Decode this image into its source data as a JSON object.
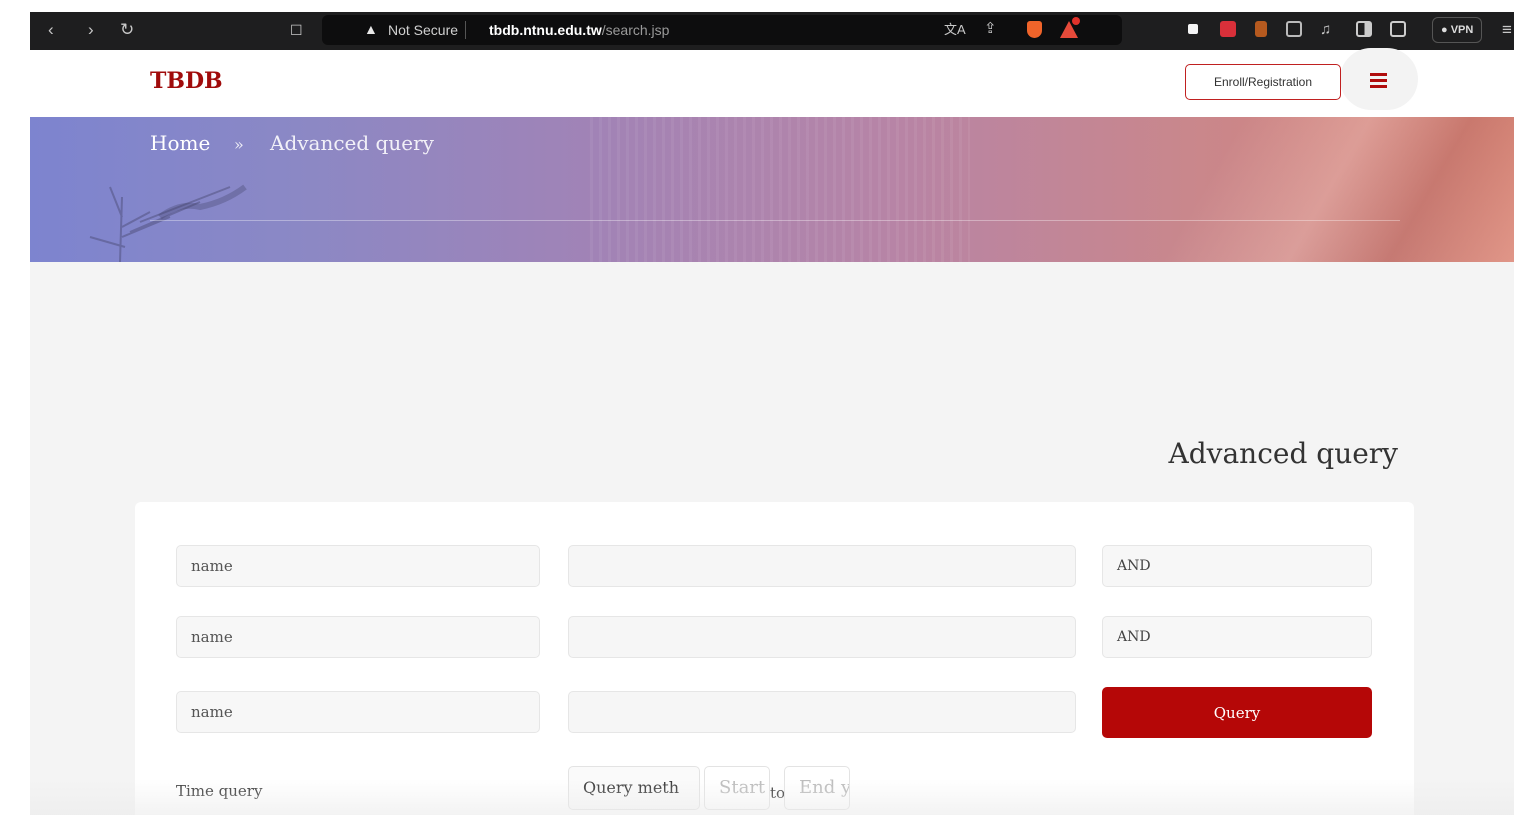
{
  "browser": {
    "nav_back": "‹",
    "nav_forward": "›",
    "reload": "↻",
    "bookmark": "☐",
    "warning_icon": "▲",
    "security_label": "Not Secure",
    "host": "tbdb.ntnu.edu.tw",
    "path": "/search.jsp",
    "translate_icon": "文A",
    "share_icon": "⇪",
    "vpn_label": "● VPN",
    "menu_icon": "≡"
  },
  "header": {
    "logo": "TBDB",
    "enroll_label": "Enroll/Registration"
  },
  "breadcrumb": {
    "home": "Home",
    "separator": "»",
    "current": "Advanced query"
  },
  "main": {
    "title": "Advanced query",
    "rows": [
      {
        "field": "name",
        "value": "",
        "logic": "AND"
      },
      {
        "field": "name",
        "value": "",
        "logic": "AND"
      },
      {
        "field": "name",
        "value": ""
      }
    ],
    "query_button": "Query",
    "time_query_label": "Time query",
    "query_method": "Query meth",
    "start_placeholder": "Start year",
    "to_label": "to",
    "end_placeholder": "End year"
  },
  "colors": {
    "brand_red": "#b50707",
    "logo_red": "#a00b0b",
    "banner_start": "#7d84cf",
    "banner_end": "#d98273"
  }
}
